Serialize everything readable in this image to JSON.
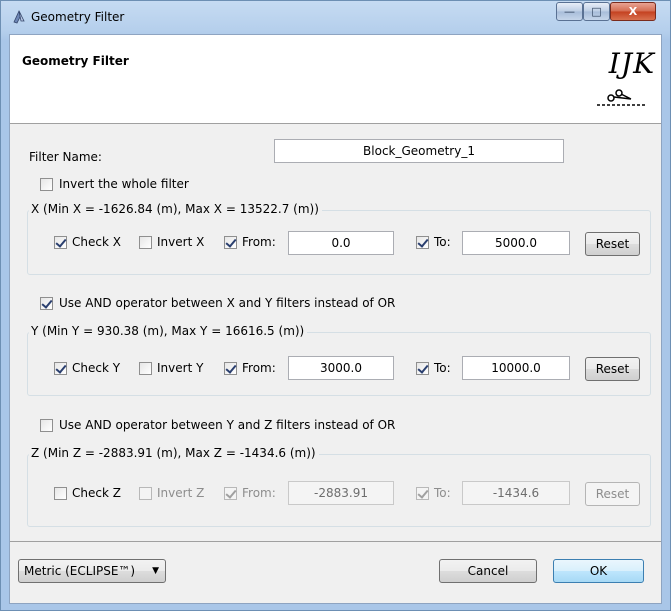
{
  "window": {
    "title": "Geometry Filter",
    "controls": {
      "minimize": "—",
      "maximize": "□",
      "close": "X"
    }
  },
  "header": {
    "title": "Geometry Filter",
    "logo_text": "IJK"
  },
  "filter_name": {
    "label": "Filter Name:",
    "value": "Block_Geometry_1"
  },
  "invert_whole": {
    "label": "Invert the whole filter",
    "checked": false
  },
  "x_group": {
    "title": "X (Min X = -1626.84 (m), Max X = 13522.7 (m))",
    "check_label": "Check X",
    "check": true,
    "invert_label": "Invert X",
    "invert": false,
    "from_label": "From:",
    "from_checked": true,
    "from_value": "0.0",
    "to_label": "To:",
    "to_checked": true,
    "to_value": "5000.0",
    "reset_label": "Reset"
  },
  "and_xy": {
    "label": "Use AND operator between X and Y filters instead of OR",
    "checked": true
  },
  "y_group": {
    "title": "Y (Min Y = 930.38 (m), Max Y = 16616.5 (m))",
    "check_label": "Check Y",
    "check": true,
    "invert_label": "Invert Y",
    "invert": false,
    "from_label": "From:",
    "from_checked": true,
    "from_value": "3000.0",
    "to_label": "To:",
    "to_checked": true,
    "to_value": "10000.0",
    "reset_label": "Reset"
  },
  "and_yz": {
    "label": "Use AND operator between Y and Z filters instead of OR",
    "checked": false
  },
  "z_group": {
    "title": "Z (Min Z = -2883.91 (m), Max Z = -1434.6 (m))",
    "check_label": "Check Z",
    "check": false,
    "invert_label": "Invert Z",
    "invert": false,
    "from_label": "From:",
    "from_checked": true,
    "from_value": "-2883.91",
    "to_label": "To:",
    "to_checked": true,
    "to_value": "-1434.6",
    "reset_label": "Reset"
  },
  "footer": {
    "unit_system": "Metric (ECLIPSE™)",
    "cancel_label": "Cancel",
    "ok_label": "OK"
  }
}
